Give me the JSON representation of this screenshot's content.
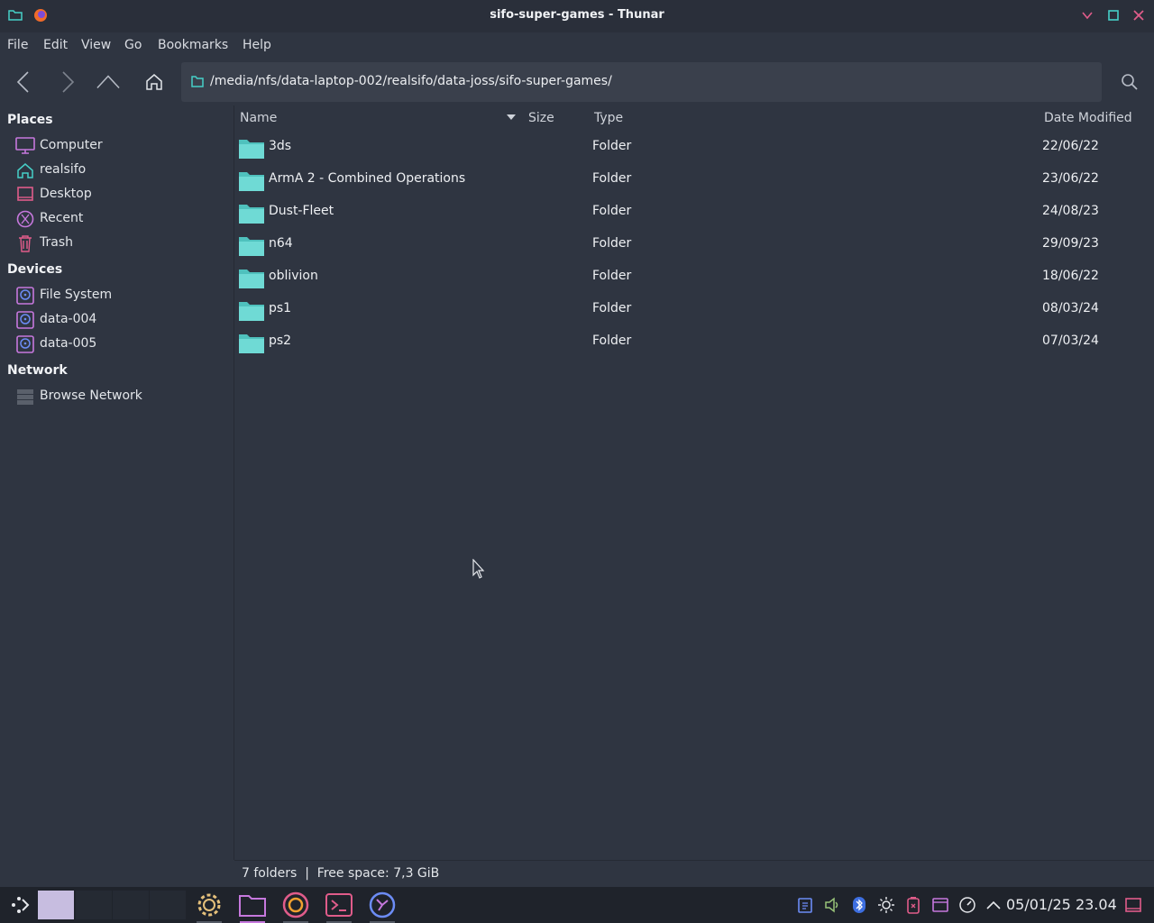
{
  "window": {
    "title": "sifo-super-games - Thunar",
    "buttons": [
      "minimize",
      "maximize",
      "close"
    ]
  },
  "menubar": {
    "items": [
      "File",
      "Edit",
      "View",
      "Go",
      "Bookmarks",
      "Help"
    ]
  },
  "toolbar": {
    "path": "/media/nfs/data-laptop-002/realsifo/data-joss/sifo-super-games/"
  },
  "sidebar": {
    "places": {
      "heading": "Places",
      "items": [
        {
          "label": "Computer",
          "icon": "computer-icon"
        },
        {
          "label": "realsifo",
          "icon": "home-icon"
        },
        {
          "label": "Desktop",
          "icon": "desktop-icon"
        },
        {
          "label": "Recent",
          "icon": "recent-icon"
        },
        {
          "label": "Trash",
          "icon": "trash-icon"
        }
      ]
    },
    "devices": {
      "heading": "Devices",
      "items": [
        {
          "label": "File System",
          "icon": "drive-icon"
        },
        {
          "label": "data-004",
          "icon": "drive-icon"
        },
        {
          "label": "data-005",
          "icon": "drive-icon"
        }
      ]
    },
    "network": {
      "heading": "Network",
      "items": [
        {
          "label": "Browse Network",
          "icon": "network-icon"
        }
      ]
    }
  },
  "filelist": {
    "columns": {
      "name": "Name",
      "size": "Size",
      "type": "Type",
      "date": "Date Modified"
    },
    "rows": [
      {
        "name": "3ds",
        "type": "Folder",
        "date": "22/06/22"
      },
      {
        "name": "ArmA 2 - Combined Operations",
        "type": "Folder",
        "date": "23/06/22"
      },
      {
        "name": "Dust-Fleet",
        "type": "Folder",
        "date": "24/08/23"
      },
      {
        "name": "n64",
        "type": "Folder",
        "date": "29/09/23"
      },
      {
        "name": "oblivion",
        "type": "Folder",
        "date": "18/06/22"
      },
      {
        "name": "ps1",
        "type": "Folder",
        "date": "08/03/24"
      },
      {
        "name": "ps2",
        "type": "Folder",
        "date": "07/03/24"
      }
    ]
  },
  "statusbar": {
    "text": "7 folders  |  Free space: 7,3 GiB"
  },
  "taskbar": {
    "clock": "05/01/25 23.04",
    "apps": [
      "settings-icon",
      "file-manager-icon",
      "browser-icon",
      "terminal-icon",
      "app-icon"
    ]
  },
  "colors": {
    "background": "#2f3541",
    "folder": "#5fd3cf",
    "accent": "#c678dd",
    "teal": "#46d0c8"
  }
}
